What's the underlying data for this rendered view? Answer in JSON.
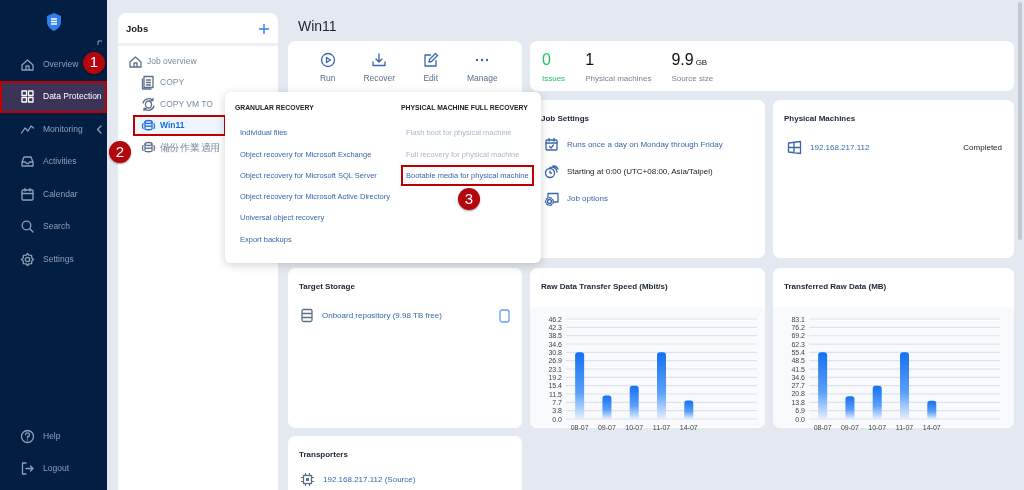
{
  "sidebar": {
    "items": [
      {
        "label": "Overview",
        "selected": false,
        "highlighted": false,
        "has_submenu": false
      },
      {
        "label": "Data Protection",
        "selected": true,
        "highlighted": true,
        "has_submenu": false,
        "callout": "1"
      },
      {
        "label": "Monitoring",
        "selected": false,
        "highlighted": false,
        "has_submenu": true
      },
      {
        "label": "Activities",
        "selected": false,
        "highlighted": false,
        "has_submenu": false
      },
      {
        "label": "Calendar",
        "selected": false,
        "highlighted": false,
        "has_submenu": false
      },
      {
        "label": "Search",
        "selected": false,
        "highlighted": false,
        "has_submenu": false
      },
      {
        "label": "Settings",
        "selected": false,
        "highlighted": false,
        "has_submenu": false
      }
    ],
    "footer_items": [
      {
        "label": "Help"
      },
      {
        "label": "Logout"
      }
    ]
  },
  "jobs_panel": {
    "title": "Jobs",
    "tree": [
      {
        "label": "Job overview",
        "selected": false,
        "highlighted": false,
        "children": [
          {
            "label": "COPY",
            "kind": "copy",
            "selected": false,
            "highlighted": false
          },
          {
            "label": "COPY VM TO",
            "kind": "sync",
            "selected": false,
            "highlighted": false
          },
          {
            "label": "Win11",
            "kind": "backup",
            "selected": true,
            "highlighted": true,
            "callout": "2"
          },
          {
            "label": "備份 作業 適用",
            "kind": "backup",
            "selected": false,
            "highlighted": false
          }
        ]
      }
    ]
  },
  "page_title": "Win11",
  "actions": [
    {
      "label": "Run"
    },
    {
      "label": "Recover"
    },
    {
      "label": "Edit"
    },
    {
      "label": "Manage"
    }
  ],
  "stats": [
    {
      "value": "0",
      "label": "Issues",
      "color": "#22c55e"
    },
    {
      "value": "1",
      "label": "Physical machines"
    },
    {
      "value": "9.9",
      "unit": "GB",
      "label": "Source size"
    }
  ],
  "recover_menu": {
    "columns": [
      {
        "heading": "GRANULAR RECOVERY",
        "items": [
          {
            "label": "Individual files",
            "disabled": false,
            "highlighted": false
          },
          {
            "label": "Object recovery for Microsoft Exchange",
            "disabled": false,
            "highlighted": false
          },
          {
            "label": "Object recovery for Microsoft SQL Server",
            "disabled": false,
            "highlighted": false
          },
          {
            "label": "Object recovery for Microsoft Active Directory",
            "disabled": false,
            "highlighted": false
          },
          {
            "label": "Universal object recovery",
            "disabled": false,
            "highlighted": false
          },
          {
            "label": "Export backups",
            "disabled": false,
            "highlighted": false
          }
        ]
      },
      {
        "heading": "PHYSICAL MACHINE FULL RECOVERY",
        "items": [
          {
            "label": "Flash boot for physical machine",
            "disabled": true,
            "highlighted": false
          },
          {
            "label": "Full recovery for physical machine",
            "disabled": true,
            "highlighted": false
          },
          {
            "label": "Bootable media for physical machine",
            "disabled": false,
            "highlighted": true,
            "callout": "3"
          }
        ]
      }
    ]
  },
  "job_settings": {
    "title": "Job Settings",
    "items": [
      {
        "text": "Runs once a day on Monday through Friday",
        "kind": "link"
      },
      {
        "text": "Starting at 0:00 (UTC+08:00, Asia/Taipei)",
        "kind": "text"
      },
      {
        "text": "Job options",
        "kind": "link"
      }
    ]
  },
  "physical_machines": {
    "title": "Physical Machines",
    "rows": [
      {
        "name": "192.168.217.112",
        "status": "Completed"
      }
    ]
  },
  "target_storage": {
    "title": "Target Storage",
    "items": [
      {
        "name": "Onboard repository (9.98 TB free)"
      }
    ]
  },
  "charts": [
    {
      "title": "Raw Data Transfer Speed (Mbit/s)",
      "chart_data": {
        "type": "bar",
        "categories": [
          "08-07",
          "09-07",
          "10-07",
          "11-07",
          "14-07"
        ],
        "values": [
          30.8,
          10.8,
          15.4,
          30.8,
          8.5
        ],
        "ylim": [
          0,
          46.2
        ],
        "grid": true,
        "yticks": [
          {
            "value": 0,
            "label": "0.0"
          },
          {
            "value": 3.85,
            "label": "3.8"
          },
          {
            "value": 7.7,
            "label": "7.7"
          },
          {
            "value": 11.55,
            "label": "11.5"
          },
          {
            "value": 15.4,
            "label": "15.4"
          },
          {
            "value": 19.25,
            "label": "19.2"
          },
          {
            "value": 23.1,
            "label": "23.1"
          },
          {
            "value": 26.95,
            "label": "26.9"
          },
          {
            "value": 30.8,
            "label": "30.8"
          },
          {
            "value": 34.65,
            "label": "34.6"
          },
          {
            "value": 38.5,
            "label": "38.5"
          },
          {
            "value": 42.35,
            "label": "42.3"
          },
          {
            "value": 46.2,
            "label": "46.2"
          }
        ]
      }
    },
    {
      "title": "Transferred Raw Data (MB)",
      "chart_data": {
        "type": "bar",
        "categories": [
          "08-07",
          "09-07",
          "10-07",
          "11-07",
          "14-07"
        ],
        "values": [
          55.4,
          18.9,
          27.7,
          55.4,
          15.2
        ],
        "ylim": [
          0,
          83.1
        ],
        "grid": true,
        "yticks": [
          {
            "value": 0,
            "label": "0.0"
          },
          {
            "value": 6.9,
            "label": "6.9"
          },
          {
            "value": 13.8,
            "label": "13.8"
          },
          {
            "value": 20.8,
            "label": "20.8"
          },
          {
            "value": 27.7,
            "label": "27.7"
          },
          {
            "value": 34.6,
            "label": "34.6"
          },
          {
            "value": 41.5,
            "label": "41.5"
          },
          {
            "value": 48.5,
            "label": "48.5"
          },
          {
            "value": 55.4,
            "label": "55.4"
          },
          {
            "value": 62.3,
            "label": "62.3"
          },
          {
            "value": 69.2,
            "label": "69.2"
          },
          {
            "value": 76.2,
            "label": "76.2"
          },
          {
            "value": 83.1,
            "label": "83.1"
          }
        ]
      }
    }
  ],
  "transporters": {
    "title": "Transporters",
    "items": [
      {
        "name": "192.168.217.112 (Source)"
      }
    ]
  }
}
